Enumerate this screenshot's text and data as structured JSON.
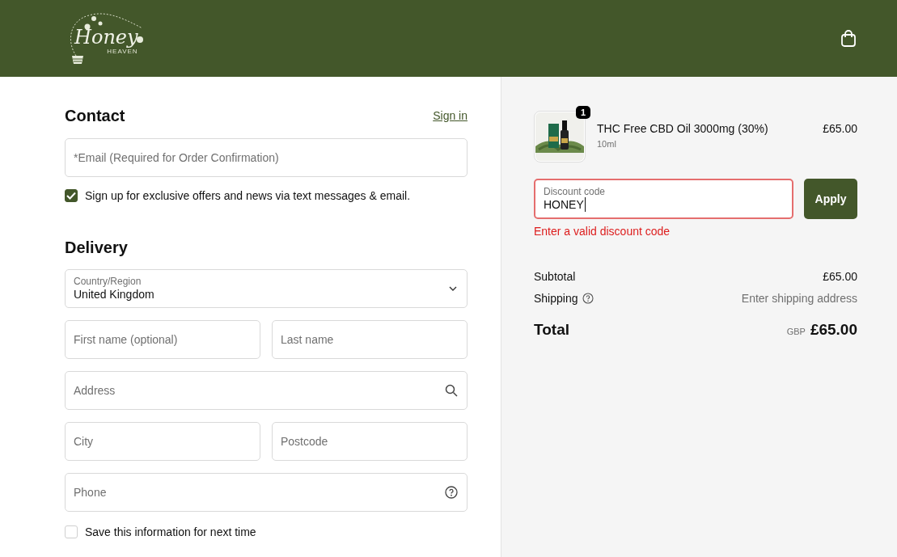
{
  "header": {
    "logo": {
      "name": "Honey",
      "tagline": "HEAVEN"
    }
  },
  "contact": {
    "title": "Contact",
    "sign_in": "Sign in",
    "email": {
      "placeholder": "*Email (Required for Order Confirmation)"
    },
    "marketing": {
      "label": "Sign up for exclusive offers and news via text messages & email.",
      "checked": true
    }
  },
  "delivery": {
    "title": "Delivery",
    "rows": [
      [
        {
          "kind": "select",
          "label": "Country/Region",
          "value": "United Kingdom"
        }
      ],
      [
        {
          "kind": "text",
          "placeholder": "First name (optional)"
        },
        {
          "kind": "text",
          "placeholder": "Last name"
        }
      ],
      [
        {
          "kind": "search",
          "placeholder": "Address"
        }
      ],
      [
        {
          "kind": "text",
          "placeholder": "City"
        },
        {
          "kind": "text",
          "placeholder": "Postcode"
        }
      ],
      [
        {
          "kind": "help",
          "placeholder": "Phone"
        }
      ]
    ],
    "save_info": {
      "label": "Save this information for next time",
      "checked": false
    }
  },
  "summary": {
    "items": [
      {
        "quantity": "1",
        "name": "THC Free CBD Oil 3000mg (30%)",
        "variant": "10ml",
        "price": "£65.00"
      }
    ],
    "discount": {
      "label": "Discount code",
      "value": "HONEY",
      "error": "Enter a valid discount code",
      "button": "Apply"
    },
    "subtotal": {
      "label": "Subtotal",
      "value": "£65.00"
    },
    "shipping": {
      "label": "Shipping",
      "value": "Enter shipping address"
    },
    "total": {
      "label": "Total",
      "currency": "GBP",
      "amount": "£65.00"
    }
  }
}
